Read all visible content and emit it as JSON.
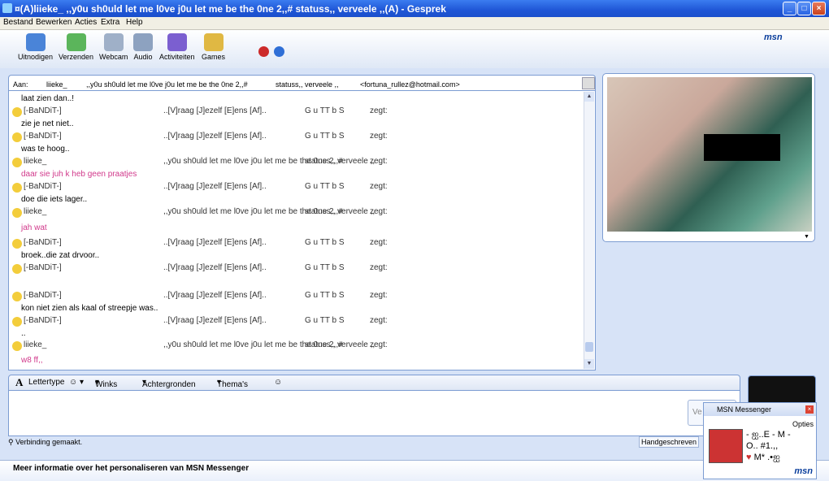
{
  "window": {
    "title": "¤(A)liieke_      ,,y0u sh0uld let me l0ve j0u let me be the 0ne 2,,#        statuss,, verveele ,,(A) - Gesprek"
  },
  "menu": [
    "Bestand",
    "Bewerken",
    "Acties",
    "Extra",
    "Help"
  ],
  "toolbar": [
    "Uitnodigen",
    "Verzenden",
    "Webcam",
    "Audio",
    "Activiteiten",
    "Games"
  ],
  "brand": "msn",
  "to_line": {
    "label": "Aan:",
    "name1": "liieke_",
    "name2": ",,y0u sh0uld let me l0ve j0u let me be the 0ne 2,,#",
    "name3": "statuss,, verveele ,,",
    "email": "<fortuna_rullez@hotmail.com>"
  },
  "messages": [
    {
      "type": "text",
      "text": "laat zien dan..!"
    },
    {
      "type": "header",
      "n1": "[-BaNDiT-]",
      "n2": "..[V]raag [J]ezelf [E]ens [Af]..",
      "n3": "G u TT b S",
      "n4": "zegt:"
    },
    {
      "type": "text",
      "text": "zie je net niet.."
    },
    {
      "type": "header",
      "n1": "[-BaNDiT-]",
      "n2": "..[V]raag [J]ezelf [E]ens [Af]..",
      "n3": "G u TT b S",
      "n4": "zegt:"
    },
    {
      "type": "text",
      "text": "was te hoog.."
    },
    {
      "type": "header",
      "n1": "liieke_",
      "n2": ",,y0u sh0uld let me l0ve j0u let me be the 0ne 2,,#",
      "n3": "statuss,, verveele ,,",
      "n4": "zegt:"
    },
    {
      "type": "text",
      "text": "daar sie juh k heb geen praatjes",
      "pink": true
    },
    {
      "type": "header",
      "n1": "[-BaNDiT-]",
      "n2": "..[V]raag [J]ezelf [E]ens [Af]..",
      "n3": "G u TT b S",
      "n4": "zegt:"
    },
    {
      "type": "text",
      "text": "doe die iets lager.."
    },
    {
      "type": "header",
      "n1": "liieke_",
      "n2": ",,y0u sh0uld let me l0ve j0u let me be the 0ne 2,,#",
      "n3": "statuss,, verveele ,,",
      "n4": "zegt:"
    },
    {
      "type": "text",
      "text": "jah wat",
      "pink": true
    },
    {
      "type": "header",
      "n1": "[-BaNDiT-]",
      "n2": "..[V]raag [J]ezelf [E]ens [Af]..",
      "n3": "G u TT b S",
      "n4": "zegt:"
    },
    {
      "type": "text",
      "text": "broek..die zat drvoor.."
    },
    {
      "type": "header",
      "n1": "[-BaNDiT-]",
      "n2": "..[V]raag [J]ezelf [E]ens [Af]..",
      "n3": "G u TT b S",
      "n4": "zegt:"
    },
    {
      "type": "text",
      "text": ""
    },
    {
      "type": "header",
      "n1": "[-BaNDiT-]",
      "n2": "..[V]raag [J]ezelf [E]ens [Af]..",
      "n3": "G u TT b S",
      "n4": "zegt:"
    },
    {
      "type": "text",
      "text": "kon niet zien als kaal of streepje was.."
    },
    {
      "type": "header",
      "n1": "[-BaNDiT-]",
      "n2": "..[V]raag [J]ezelf [E]ens [Af]..",
      "n3": "G u TT b S",
      "n4": "zegt:"
    },
    {
      "type": "text",
      "text": ".."
    },
    {
      "type": "header",
      "n1": "liieke_",
      "n2": ",,y0u sh0uld let me l0ve j0u let me be the 0ne 2,,#",
      "n3": "statuss,, verveele ,,",
      "n4": "zegt:"
    },
    {
      "type": "text",
      "text": "w8 ff,,",
      "pink": true
    }
  ],
  "formatbar": {
    "font": "Lettertype",
    "winks": "Winks",
    "backgrounds": "Achtergronden",
    "themes": "Thema's"
  },
  "send_partial": "Ve",
  "handwriting": "Handgeschreven",
  "status": "Verbinding gemaakt.",
  "bottom_link": "Meer informatie over het personaliseren van MSN Messenger",
  "toast": {
    "title": "MSN Messenger",
    "options": "Opties",
    "line1": "- ஐ..E - M -",
    "line2": "O.. #1.,,",
    "line3": "M* .•ஐ",
    "logo": "msn"
  }
}
